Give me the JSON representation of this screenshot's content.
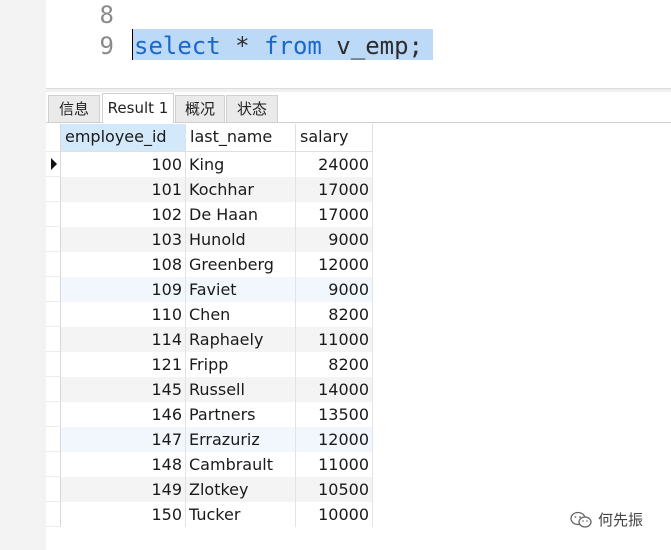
{
  "editor": {
    "lines": [
      {
        "number": "8",
        "code": ""
      },
      {
        "number": "9",
        "keyword1": "select",
        "middle": " * ",
        "keyword2": "from",
        "rest": " v_emp;"
      }
    ]
  },
  "tabs": [
    {
      "label": "信息",
      "active": false
    },
    {
      "label": "Result 1",
      "active": true
    },
    {
      "label": "概况",
      "active": false
    },
    {
      "label": "状态",
      "active": false
    }
  ],
  "grid": {
    "columns": [
      "employee_id",
      "last_name",
      "salary"
    ],
    "rows": [
      [
        "100",
        "King",
        "24000"
      ],
      [
        "101",
        "Kochhar",
        "17000"
      ],
      [
        "102",
        "De Haan",
        "17000"
      ],
      [
        "103",
        "Hunold",
        "9000"
      ],
      [
        "108",
        "Greenberg",
        "12000"
      ],
      [
        "109",
        "Faviet",
        "9000"
      ],
      [
        "110",
        "Chen",
        "8200"
      ],
      [
        "114",
        "Raphaely",
        "11000"
      ],
      [
        "121",
        "Fripp",
        "8200"
      ],
      [
        "145",
        "Russell",
        "14000"
      ],
      [
        "146",
        "Partners",
        "13500"
      ],
      [
        "147",
        "Errazuriz",
        "12000"
      ],
      [
        "148",
        "Cambrault",
        "11000"
      ],
      [
        "149",
        "Zlotkey",
        "10500"
      ],
      [
        "150",
        "Tucker",
        "10000"
      ]
    ]
  },
  "watermark": {
    "text": "何先振",
    "icon": "wechat-icon"
  },
  "colors": {
    "keyword": "#1a68c9",
    "selection": "#bcd9f7",
    "header_selected": "#d3e8fb"
  }
}
